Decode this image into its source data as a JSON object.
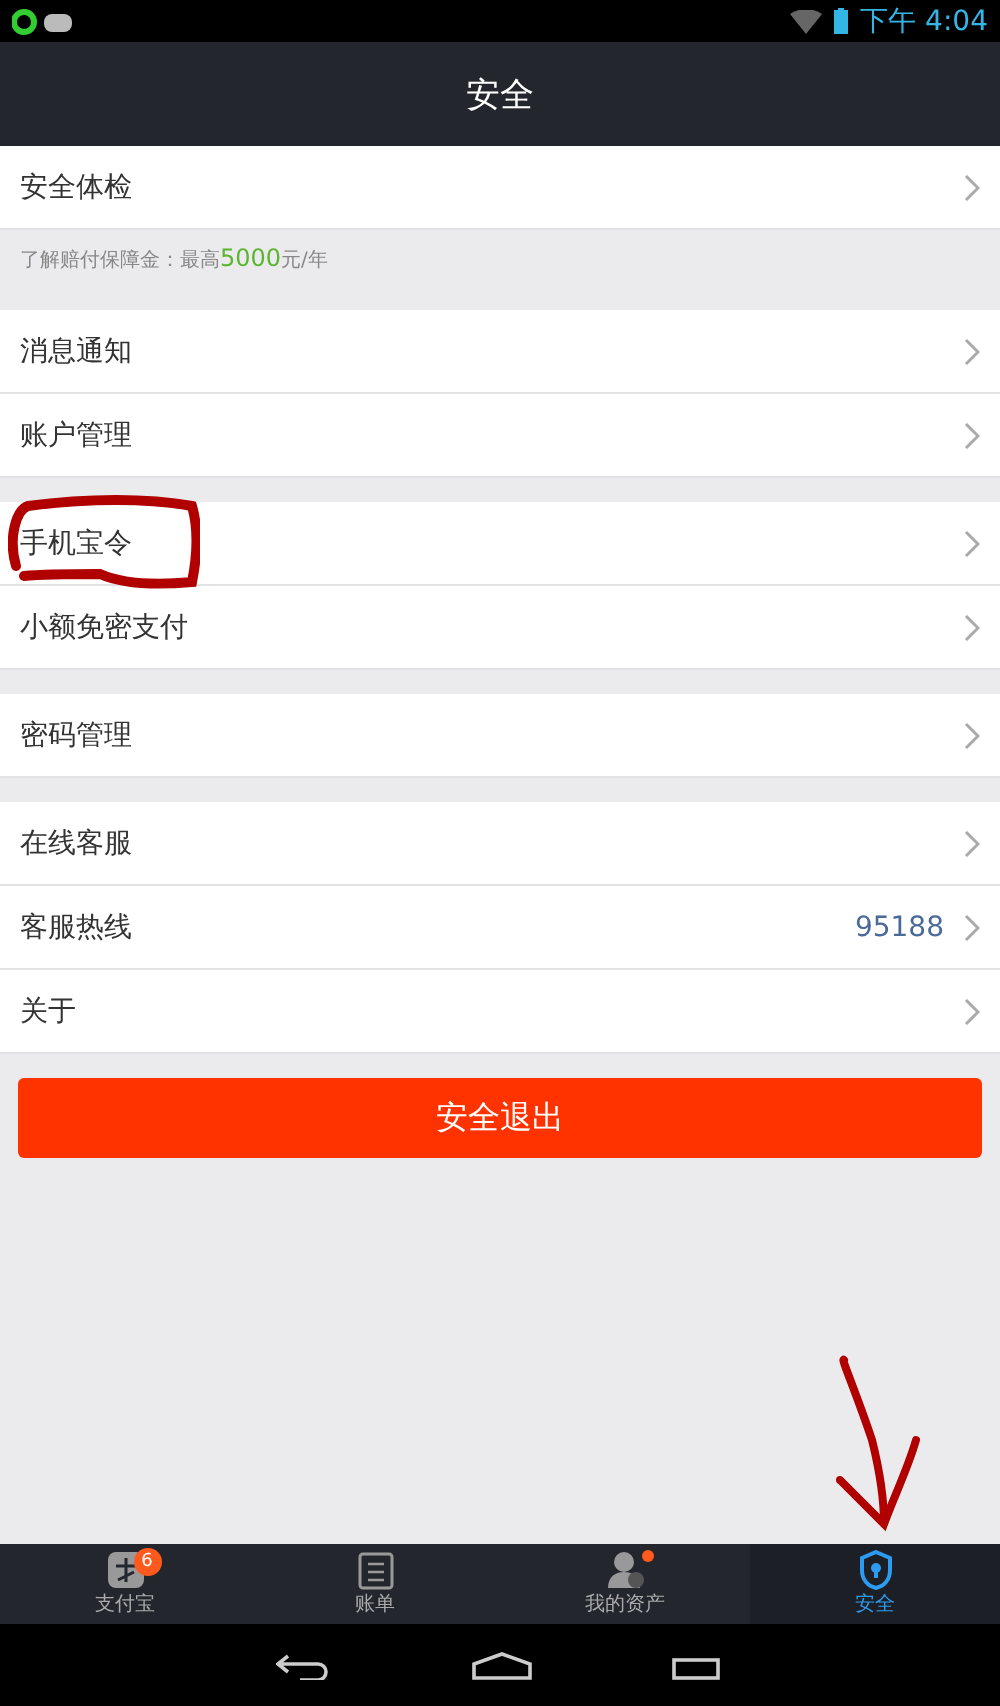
{
  "status_bar": {
    "time": "下午 4:04"
  },
  "header": {
    "title": "安全"
  },
  "sections": [
    {
      "items": [
        {
          "label": "安全体检"
        }
      ],
      "note": {
        "before": "了解赔付保障金：最高",
        "highlight": "5000",
        "after": "元/年"
      }
    },
    {
      "items": [
        {
          "label": "消息通知"
        },
        {
          "label": "账户管理"
        }
      ]
    },
    {
      "items": [
        {
          "label": "手机宝令"
        },
        {
          "label": "小额免密支付"
        }
      ]
    },
    {
      "items": [
        {
          "label": "密码管理"
        }
      ]
    },
    {
      "items": [
        {
          "label": "在线客服"
        },
        {
          "label": "客服热线",
          "value": "95188"
        },
        {
          "label": "关于"
        }
      ]
    }
  ],
  "logout_button": "安全退出",
  "tabs": [
    {
      "kind": "wallet",
      "label": "支付宝",
      "badge": "6",
      "selected": false
    },
    {
      "kind": "bill",
      "label": "账单",
      "selected": false
    },
    {
      "kind": "assets",
      "label": "我的资产",
      "dot": true,
      "selected": false
    },
    {
      "kind": "shield",
      "label": "安全",
      "selected": true
    }
  ]
}
